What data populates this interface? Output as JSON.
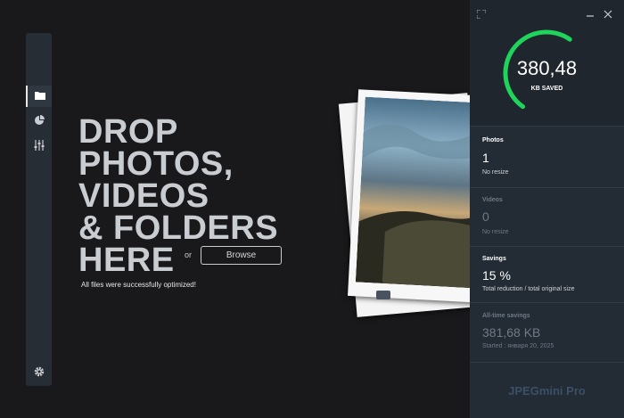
{
  "main": {
    "drop_lines": [
      "DROP",
      "PHOTOS,",
      "VIDEOS",
      "& FOLDERS",
      "HERE"
    ],
    "or_label": "or",
    "browse_label": "Browse",
    "status_message": "All files were successfully optimized!"
  },
  "sidebar": {
    "items": [
      {
        "icon": "folder-icon",
        "active": true
      },
      {
        "icon": "pie-chart-icon",
        "active": false
      },
      {
        "icon": "sliders-icon",
        "active": false
      }
    ],
    "bottom_icon": "gear-icon"
  },
  "panel": {
    "gauge": {
      "value": "380,48",
      "label": "KB SAVED",
      "color": "#1fd45a",
      "fill_fraction": 0.62
    },
    "photos": {
      "title": "Photos",
      "count": "1",
      "sub": "No resize"
    },
    "videos": {
      "title": "Videos",
      "count": "0",
      "sub": "No resize"
    },
    "savings": {
      "title": "Savings",
      "value": "15 %",
      "sub": "Total reduction / total original size"
    },
    "alltime": {
      "title": "All-time savings",
      "value": "381,68 KB",
      "sub": "Started : января 20, 2025"
    },
    "brand": "JPEGmini Pro"
  },
  "colors": {
    "accent_green": "#1fd45a",
    "panel_bg": "#232b34",
    "main_bg": "#19191b"
  }
}
